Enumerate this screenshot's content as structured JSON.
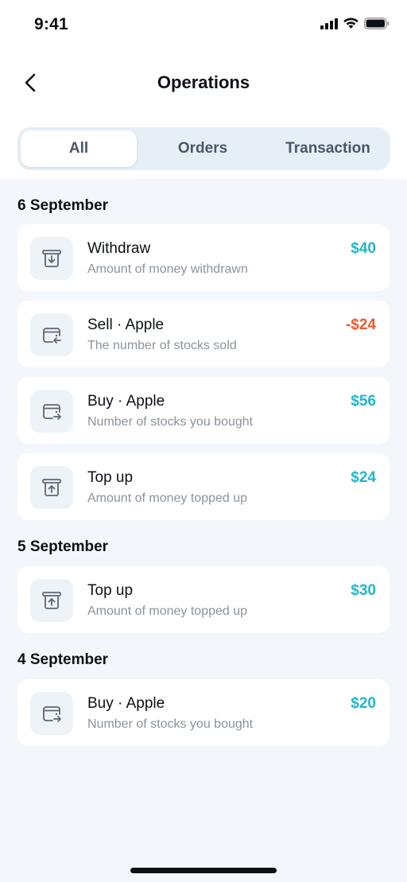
{
  "status": {
    "time": "9:41"
  },
  "header": {
    "title": "Operations"
  },
  "tabs": [
    {
      "label": "All",
      "active": true
    },
    {
      "label": "Orders",
      "active": false
    },
    {
      "label": "Transaction",
      "active": false
    }
  ],
  "colors": {
    "positive": "#21b6c9",
    "negative": "#ea5a2b",
    "icon": "#5c6877"
  },
  "sections": [
    {
      "date": "6 September",
      "items": [
        {
          "icon": "withdraw-icon",
          "title": "Withdraw",
          "subtitle": "Amount of money withdrawn",
          "amount": "$40",
          "negative": false
        },
        {
          "icon": "sell-icon",
          "title": "Sell · Apple",
          "subtitle": "The number of stocks sold",
          "amount": "-$24",
          "negative": true
        },
        {
          "icon": "buy-icon",
          "title": "Buy · Apple",
          "subtitle": "Number of stocks you bought",
          "amount": "$56",
          "negative": false
        },
        {
          "icon": "topup-icon",
          "title": "Top up",
          "subtitle": "Amount of money topped up",
          "amount": "$24",
          "negative": false
        }
      ]
    },
    {
      "date": "5 September",
      "items": [
        {
          "icon": "topup-icon",
          "title": "Top up",
          "subtitle": "Amount of money topped up",
          "amount": "$30",
          "negative": false
        }
      ]
    },
    {
      "date": "4 September",
      "items": [
        {
          "icon": "buy-icon",
          "title": "Buy · Apple",
          "subtitle": "Number of stocks you bought",
          "amount": "$20",
          "negative": false
        }
      ]
    }
  ]
}
